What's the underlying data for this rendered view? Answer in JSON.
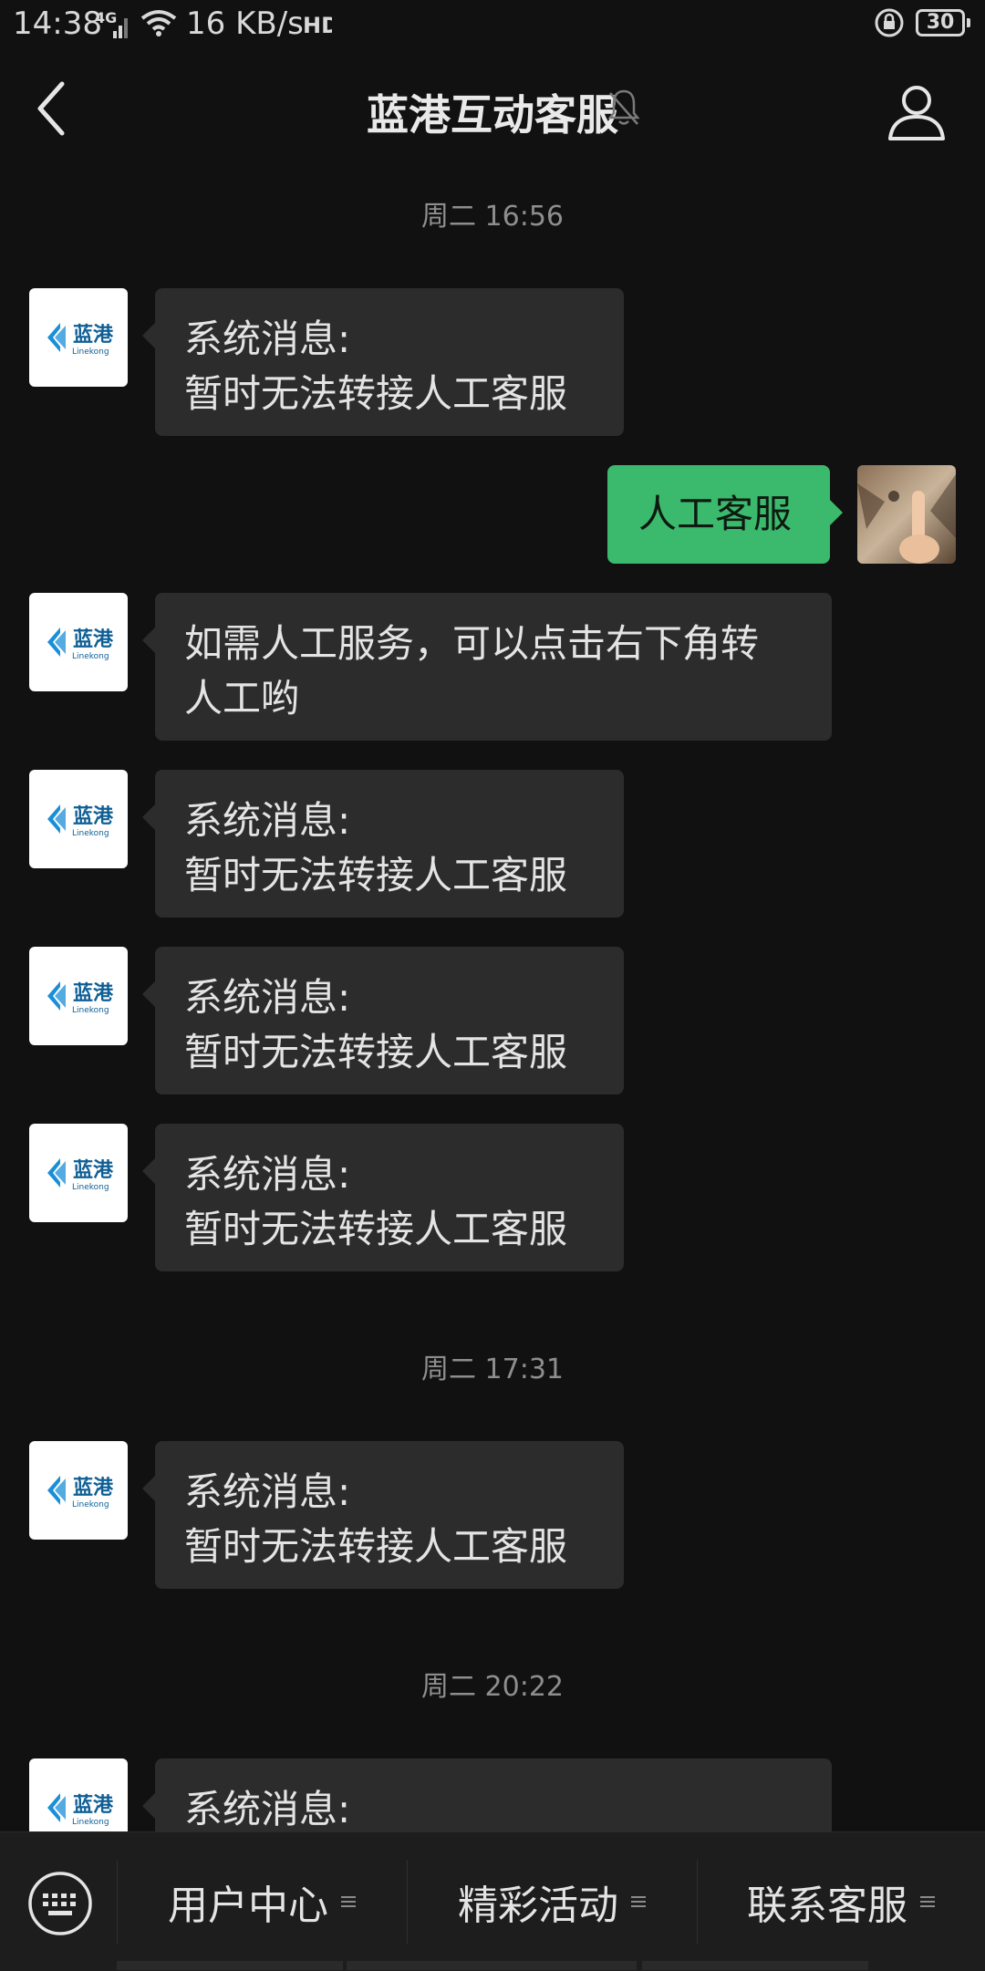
{
  "status_bar": {
    "time": "14:38",
    "network": "4G",
    "speed": "16 KB/s",
    "battery": "30"
  },
  "header": {
    "title": "蓝港互动客服"
  },
  "bot": {
    "logo_text": "蓝港",
    "logo_subtext": "Linekong",
    "logo_color": "#1a8fd8"
  },
  "messages": [
    {
      "timestamp": "周二 16:56"
    },
    {
      "line1": "系统消息:",
      "line2": "暂时无法转接人工客服"
    },
    {
      "line1": "人工客服"
    },
    {
      "line1": "如需人工服务，可以点击右下角转",
      "line2": "人工哟"
    },
    {
      "line1": "系统消息:",
      "line2": "暂时无法转接人工客服"
    },
    {
      "line1": "系统消息:",
      "line2": "暂时无法转接人工客服"
    },
    {
      "line1": "系统消息:",
      "line2": "暂时无法转接人工客服"
    },
    {
      "timestamp": "周二 17:31"
    },
    {
      "line1": "系统消息:",
      "line2": "暂时无法转接人工客服"
    },
    {
      "timestamp": "周二 20:22"
    },
    {
      "line1": "系统消息:"
    }
  ],
  "bottom_menu": [
    {
      "label": "用户中心"
    },
    {
      "label": "精彩活动"
    },
    {
      "label": "联系客服"
    }
  ],
  "colors": {
    "background": "#111111",
    "incoming_bubble": "#2c2c2c",
    "outgoing_bubble": "#3bb96c",
    "bottom_bar": "#1d1d1d"
  }
}
